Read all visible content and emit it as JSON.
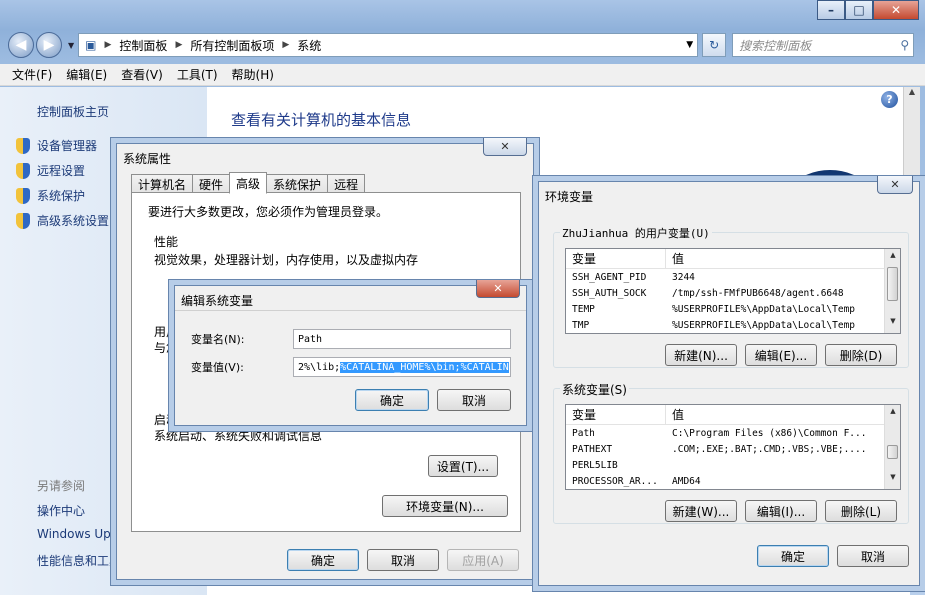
{
  "explorer": {
    "nav": {
      "back": "back",
      "forward": "forward"
    },
    "breadcrumb": [
      "控制面板",
      "所有控制面板项",
      "系统"
    ],
    "search_placeholder": "搜索控制面板",
    "menu": [
      "文件(F)",
      "编辑(E)",
      "查看(V)",
      "工具(T)",
      "帮助(H)"
    ],
    "sidebar": {
      "home": "控制面板主页",
      "links": [
        "设备管理器",
        "远程设置",
        "系统保护",
        "高级系统设置"
      ],
      "see_also": "另请参阅",
      "see_also_links": [
        "操作中心",
        "Windows Update",
        "性能信息和工具"
      ]
    },
    "heading": "查看有关计算机的基本信息"
  },
  "system_properties": {
    "title": "系统属性",
    "tabs": [
      "计算机名",
      "硬件",
      "高级",
      "系统保护",
      "远程"
    ],
    "active_tab": "高级",
    "admin_note": "要进行大多数更改，您必须作为管理员登录。",
    "performance": {
      "label": "性能",
      "desc": "视觉效果，处理器计划，内存使用，以及虚拟内存"
    },
    "user_profile": {
      "label": "用户",
      "desc": "与您"
    },
    "startup": {
      "label": "启动",
      "desc": "系统启动、系统失败和调试信息",
      "settings_button": "设置(T)..."
    },
    "env_button": "环境变量(N)...",
    "ok": "确定",
    "cancel": "取消",
    "apply": "应用(A)"
  },
  "edit_variable": {
    "title": "编辑系统变量",
    "name_label": "变量名(N):",
    "name_value": "Path",
    "value_label": "变量值(V):",
    "value_prefix": "2%\\lib;",
    "value_selected": "%CATALINA_HOME%\\bin;%CATALIN",
    "ok": "确定",
    "cancel": "取消"
  },
  "env_vars": {
    "title": "环境变量",
    "user_group": "ZhuJianhua 的用户变量(U)",
    "col_var": "变量",
    "col_val": "值",
    "user_vars": [
      {
        "name": "SSH_AGENT_PID",
        "value": "3244"
      },
      {
        "name": "SSH_AUTH_SOCK",
        "value": "/tmp/ssh-FMfPUB6648/agent.6648"
      },
      {
        "name": "TEMP",
        "value": "%USERPROFILE%\\AppData\\Local\\Temp"
      },
      {
        "name": "TMP",
        "value": "%USERPROFILE%\\AppData\\Local\\Temp"
      }
    ],
    "system_group": "系统变量(S)",
    "system_vars": [
      {
        "name": "Path",
        "value": "C:\\Program Files (x86)\\Common F..."
      },
      {
        "name": "PATHEXT",
        "value": ".COM;.EXE;.BAT;.CMD;.VBS;.VBE;...."
      },
      {
        "name": "PERL5LIB",
        "value": ""
      },
      {
        "name": "PROCESSOR_AR...",
        "value": "AMD64"
      }
    ],
    "new_user": "新建(N)...",
    "edit_user": "编辑(E)...",
    "delete_user": "删除(D)",
    "new_sys": "新建(W)...",
    "edit_sys": "编辑(I)...",
    "delete_sys": "删除(L)",
    "ok": "确定",
    "cancel": "取消"
  }
}
